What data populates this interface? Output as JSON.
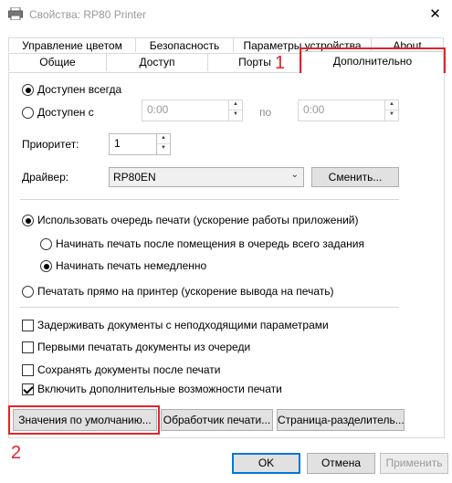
{
  "window": {
    "title": "Свойства: RP80 Printer",
    "close_glyph": "✕"
  },
  "tabs_row1": [
    "Управление цветом",
    "Безопасность",
    "Параметры устройства",
    "About"
  ],
  "tabs_row2": [
    "Общие",
    "Доступ",
    "Порты",
    "Дополнительно"
  ],
  "availability": {
    "always_label": "Доступен всегда",
    "from_label": "Доступен с",
    "from_value": "0:00",
    "to_label": "по",
    "to_value": "0:00"
  },
  "priority": {
    "label": "Приоритет:",
    "value": "1"
  },
  "driver": {
    "label": "Драйвер:",
    "value": "RP80EN",
    "change_button": "Сменить..."
  },
  "spooling": {
    "use_spool_label": "Использовать очередь печати (ускорение работы приложений)",
    "after_last_page_label": "Начинать печать после помещения в очередь всего задания",
    "immediately_label": "Начинать печать немедленно",
    "direct_label": "Печатать прямо на принтер (ускорение вывода на печать)"
  },
  "options": {
    "hold_mismatched": "Задерживать документы с неподходящими параметрами",
    "spooled_first": "Первыми печатать документы из очереди",
    "keep_printed": "Сохранять документы после печати",
    "advanced_features": "Включить дополнительные возможности печати"
  },
  "bottom_buttons": {
    "defaults": "Значения по умолчанию...",
    "processor": "Обработчик печати...",
    "separator": "Страница-разделитель..."
  },
  "dialog_buttons": {
    "ok": "OK",
    "cancel": "Отмена",
    "apply": "Применить"
  },
  "annotations": {
    "marker1": "1",
    "marker2": "2",
    "color": "#e3242b"
  }
}
